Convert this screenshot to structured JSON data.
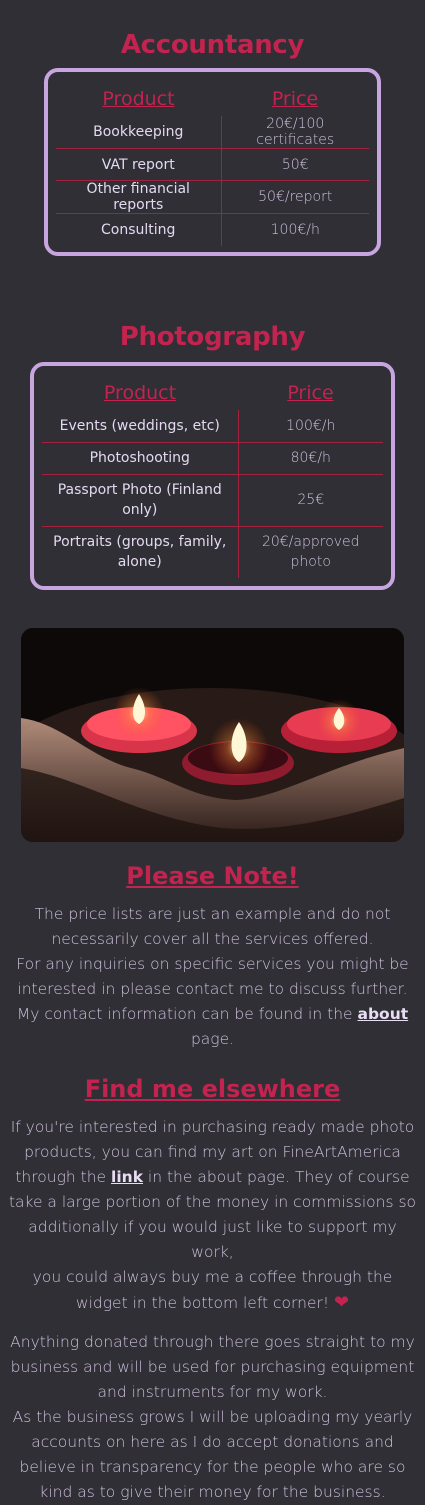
{
  "accountancy": {
    "title": "Accountancy",
    "header_product": "Product",
    "header_price": "Price",
    "rows": [
      {
        "product": "Bookkeeping",
        "price": "20€/100 certificates"
      },
      {
        "product": "VAT report",
        "price": "50€"
      },
      {
        "product": "Other financial reports",
        "price": "50€/report"
      },
      {
        "product": "Consulting",
        "price": "100€/h"
      }
    ]
  },
  "photography": {
    "title": "Photography",
    "header_product": "Product",
    "header_price": "Price",
    "rows": [
      {
        "product": "Events (weddings, etc)",
        "price": "100€/h"
      },
      {
        "product": "Photoshooting",
        "price": "80€/h"
      },
      {
        "product": "Passport Photo (Finland only)",
        "price": "25€"
      },
      {
        "product": "Portraits (groups, family, alone)",
        "price": "20€/approved photo"
      }
    ]
  },
  "note": {
    "title": "Please Note!",
    "line1": "The price lists are just an example and do not necessarily cover all the services offered.",
    "line2": "For any inquiries on specific services you might be interested in please contact me to discuss further.",
    "line3_pre": "My contact information can be found in the ",
    "line3_link": "about",
    "line3_post": " page."
  },
  "elsewhere": {
    "title": "Find me elsewhere",
    "p1_a": "If you're interested in purchasing ready made photo products, you can find my art on FineArtAmerica through the ",
    "p1_link": "link",
    "p1_b": " in the about page. They of course take a large portion of the money in commissions so additionally if you would just like to support my work,",
    "p1_c": "you could always buy me a coffee through the widget in the bottom left corner! ",
    "p2_a": "Anything donated through there goes straight to my business and will be used for purchasing equipment and instruments for my work.",
    "p2_b": "As the business grows I will be uploading my yearly accounts on here as I do accept donations and believe in transparency for the people who are so kind as to give their money for the business."
  },
  "icons": {
    "heart": "heart-icon"
  },
  "colors": {
    "accent": "#c2234f",
    "border": "#c7a6df",
    "background": "#2f2f35"
  }
}
